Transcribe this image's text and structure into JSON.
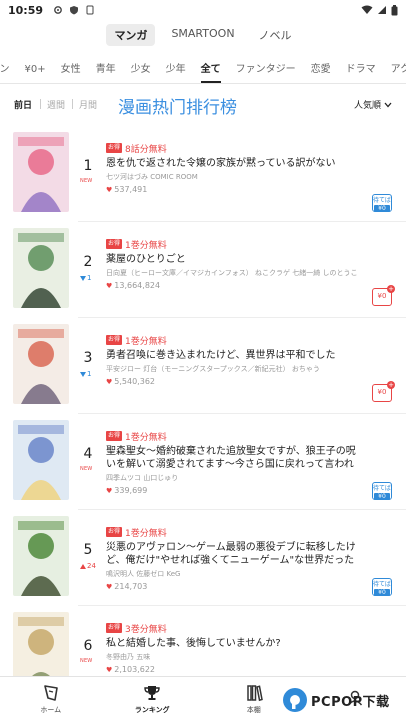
{
  "status_bar": {
    "time": "10:59"
  },
  "top_tabs": [
    {
      "label": "マンガ",
      "active": true
    },
    {
      "label": "SMARTOON",
      "active": false
    },
    {
      "label": "ノベル",
      "active": false
    }
  ],
  "genres": [
    {
      "label": "ーン",
      "active": false
    },
    {
      "label": "¥0+",
      "active": false
    },
    {
      "label": "女性",
      "active": false
    },
    {
      "label": "青年",
      "active": false
    },
    {
      "label": "少女",
      "active": false
    },
    {
      "label": "少年",
      "active": false
    },
    {
      "label": "全て",
      "active": true
    },
    {
      "label": "ファンタジー",
      "active": false
    },
    {
      "label": "恋愛",
      "active": false
    },
    {
      "label": "ドラマ",
      "active": false
    },
    {
      "label": "アクション",
      "active": false
    }
  ],
  "periods": [
    {
      "label": "前日",
      "active": true
    },
    {
      "label": "週間",
      "active": false
    },
    {
      "label": "月間",
      "active": false
    }
  ],
  "ranking_title": "漫画热门排行榜",
  "sort_label": "人気順",
  "rankings": [
    {
      "rank": "1",
      "delta_type": "new",
      "delta": "NEW",
      "promo_tag": "お得",
      "promo": "8話分無料",
      "title": "恩を仇で返された令嬢の家族が黙っている訳がない",
      "author": "七ツ河はづみ COMIC ROOM",
      "likes": "537,491",
      "badge_type": "blue",
      "badge_top": "待てば",
      "badge_bottom": "¥0",
      "cover_colors": [
        "#f3dbe6",
        "#e86a8a",
        "#8e6fc2"
      ]
    },
    {
      "rank": "2",
      "delta_type": "down",
      "delta": "1",
      "promo_tag": "お得",
      "promo": "1巻分無料",
      "title": "薬屋のひとりごと",
      "author": "日向夏（ヒーロー文庫／イマジカインフォス） ねこクラゲ 七緒一綺 しのとうこ",
      "likes": "13,664,824",
      "badge_type": "red",
      "badge_top": "",
      "badge_bottom": "¥0",
      "cover_colors": [
        "#e9efe3",
        "#5c8f5a",
        "#2a3d2a"
      ]
    },
    {
      "rank": "3",
      "delta_type": "down",
      "delta": "1",
      "promo_tag": "お得",
      "promo": "1巻分無料",
      "title": "勇者召喚に巻き込まれたけど、異世界は平和でした",
      "author": "平安ジロー 灯台（モーニングスタープックス／新紀元社） おちゃう",
      "likes": "5,540,362",
      "badge_type": "red",
      "badge_top": "",
      "badge_bottom": "¥0",
      "cover_colors": [
        "#f4ece6",
        "#d96a55",
        "#6b5f78"
      ]
    },
    {
      "rank": "4",
      "delta_type": "new",
      "delta": "NEW",
      "promo_tag": "お得",
      "promo": "1巻分無料",
      "title": "聖森聖女～婚約破棄された追放聖女ですが、狼王子の呪いを解いて溺愛されてます～今さら国に戻れって言われても遅いです！～",
      "author": "四季ムツコ 山口じゅり",
      "likes": "339,699",
      "badge_type": "blue",
      "badge_top": "待てば",
      "badge_bottom": "¥0",
      "cover_colors": [
        "#dfe9f3",
        "#6b86c9",
        "#f0d27a"
      ]
    },
    {
      "rank": "5",
      "delta_type": "up",
      "delta": "24",
      "promo_tag": "お得",
      "promo": "1巻分無料",
      "title": "災悪のアヴァロン～ゲーム最弱の悪役デブに転移したけど、俺だけ\"やせれば強くてニューゲーム\"な世界だったので、最強を目指します～",
      "author": "鳴沢明人 佐藤ゼロ KeG",
      "likes": "214,703",
      "badge_type": "blue",
      "badge_top": "待てば",
      "badge_bottom": "¥0",
      "cover_colors": [
        "#e6efe1",
        "#4f8a3c",
        "#3b4a2c"
      ]
    },
    {
      "rank": "6",
      "delta_type": "new",
      "delta": "NEW",
      "promo_tag": "お得",
      "promo": "3巻分無料",
      "title": "私と結婚した事、後悔していませんか?",
      "author": "冬野由乃 五味",
      "likes": "2,103,622",
      "badge_type": "none",
      "badge_top": "",
      "badge_bottom": "",
      "cover_colors": [
        "#f5efe1",
        "#c7a96b",
        "#7a8b5a"
      ]
    }
  ],
  "bottom_nav": [
    {
      "label": "ホーム",
      "icon": "home-icon",
      "active": false
    },
    {
      "label": "ランキング",
      "icon": "trophy-icon",
      "active": true
    },
    {
      "label": "本棚",
      "icon": "bookshelf-icon",
      "active": false
    },
    {
      "label": "",
      "icon": "profile-icon",
      "active": false
    }
  ],
  "watermark": {
    "text": "PCPOP下载"
  },
  "colors": {
    "accent_blue": "#2f8ad8",
    "accent_red": "#e84545",
    "title_blue": "#3b8fe0"
  }
}
